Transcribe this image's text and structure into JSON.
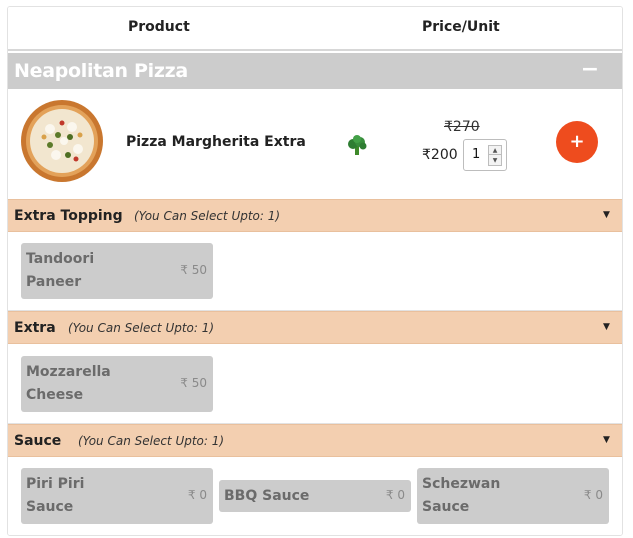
{
  "table_header": {
    "product": "Product",
    "price_unit": "Price/Unit"
  },
  "category": {
    "title": "Neapolitan Pizza",
    "collapse_symbol": "−"
  },
  "product": {
    "name": "Pizza Margherita Extra",
    "old_price": "₹270",
    "new_price": "₹200",
    "quantity": "1",
    "add_symbol": "+",
    "image_icon": "pizza-image",
    "veg_icon": "broccoli-icon"
  },
  "addon_groups": [
    {
      "title": "Extra Topping",
      "note": "(You Can Select Upto: 1)",
      "caret": "▼",
      "options": [
        {
          "line1": "Tandoori",
          "line2": "Paneer",
          "price": "₹ 50"
        }
      ]
    },
    {
      "title": "Extra",
      "note": "(You Can Select Upto: 1)",
      "caret": "▼",
      "options": [
        {
          "line1": "Mozzarella",
          "line2": "Cheese",
          "price": "₹ 50"
        }
      ]
    },
    {
      "title": "Sauce",
      "note": "(You Can Select Upto: 1)",
      "caret": "▼",
      "options": [
        {
          "line1": "Piri Piri",
          "line2": "Sauce",
          "price": "₹ 0"
        },
        {
          "line1": "BBQ Sauce",
          "line2": "",
          "price": "₹ 0"
        },
        {
          "line1": "Schezwan",
          "line2": "Sauce",
          "price": "₹ 0"
        }
      ]
    }
  ],
  "colors": {
    "accent_add_button": "#ee4c1e",
    "addon_header_bg": "#f3cfb0",
    "category_bg": "#cccccc",
    "chip_bg": "#cccccc"
  }
}
